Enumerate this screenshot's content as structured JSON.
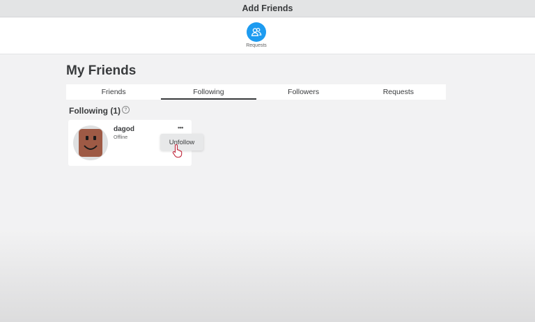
{
  "window": {
    "title": "Add Friends"
  },
  "requests_panel": {
    "label": "Requests",
    "icon": "friends-icon",
    "accent": "#1d9bf0"
  },
  "page": {
    "title": "My Friends"
  },
  "tabs": [
    {
      "label": "Friends",
      "active": false
    },
    {
      "label": "Following",
      "active": true
    },
    {
      "label": "Followers",
      "active": false
    },
    {
      "label": "Requests",
      "active": false
    }
  ],
  "section": {
    "heading": "Following (1)",
    "help_icon": "question-circle-icon"
  },
  "friend": {
    "username": "dagod",
    "status": "Offline",
    "avatar_color": "#9e5a45",
    "more_icon": "ellipsis-icon"
  },
  "context_menu": {
    "items": [
      {
        "label": "Unfollow"
      }
    ]
  }
}
